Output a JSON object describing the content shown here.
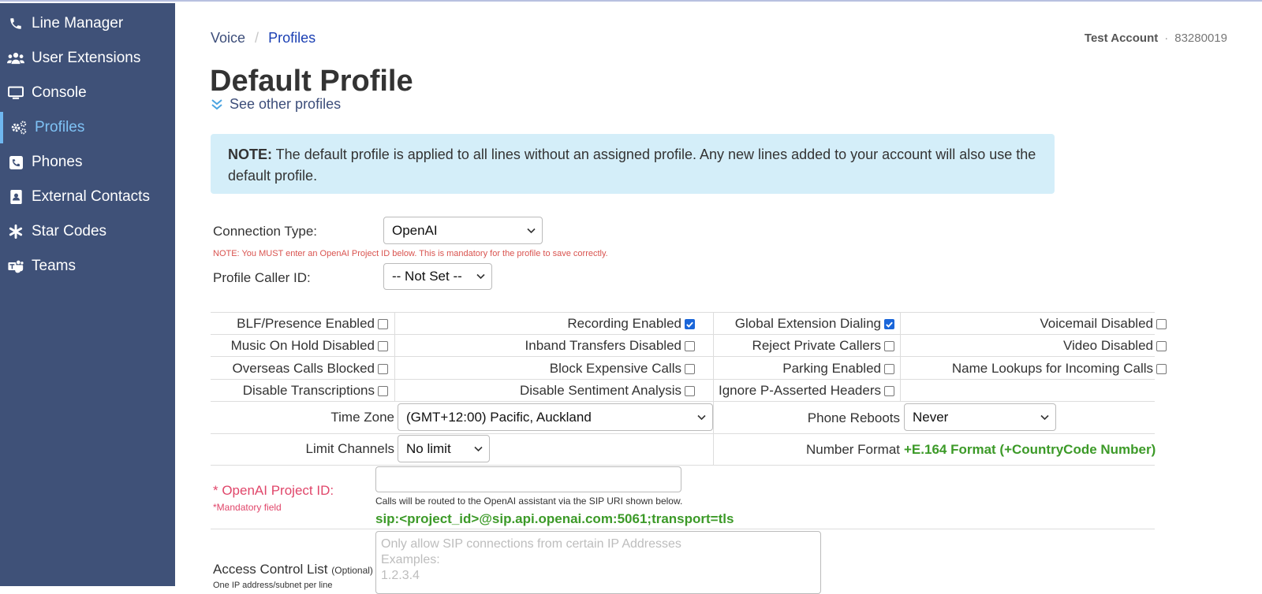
{
  "sidebar": {
    "items": [
      {
        "label": "Line Manager",
        "icon": "phone-icon"
      },
      {
        "label": "User Extensions",
        "icon": "users-icon"
      },
      {
        "label": "Console",
        "icon": "monitor-icon"
      },
      {
        "label": "Profiles",
        "icon": "gears-icon",
        "active": true
      },
      {
        "label": "Phones",
        "icon": "phone-square-icon"
      },
      {
        "label": "External Contacts",
        "icon": "contact-card-icon"
      },
      {
        "label": "Star Codes",
        "icon": "asterisk-icon"
      },
      {
        "label": "Teams",
        "icon": "teams-icon"
      }
    ]
  },
  "breadcrumb": {
    "root": "Voice",
    "separator": "/",
    "current": "Profiles"
  },
  "account": {
    "name": "Test Account",
    "separator": "·",
    "number": "83280019"
  },
  "page": {
    "title": "Default Profile",
    "see_other": "See other profiles"
  },
  "note": {
    "bold": "NOTE:",
    "text": " The default profile is applied to all lines without an assigned profile. Any new lines added to your account will also use the default profile."
  },
  "connection": {
    "label": "Connection Type:",
    "value": "OpenAI",
    "warning": "NOTE: You MUST enter an OpenAI Project ID below. This is mandatory for the profile to save correctly."
  },
  "caller_id": {
    "label": "Profile Caller ID:",
    "value": "-- Not Set --"
  },
  "options": {
    "col1": [
      {
        "label": "BLF/Presence Enabled",
        "checked": false
      },
      {
        "label": "Music On Hold Disabled",
        "checked": false
      },
      {
        "label": "Overseas Calls Blocked",
        "checked": false
      },
      {
        "label": "Disable Transcriptions",
        "checked": false
      }
    ],
    "col2": [
      {
        "label": "Recording Enabled",
        "checked": true
      },
      {
        "label": "Inband Transfers Disabled",
        "checked": false
      },
      {
        "label": "Block Expensive Calls",
        "checked": false
      },
      {
        "label": "Disable Sentiment Analysis",
        "checked": false
      }
    ],
    "col3": [
      {
        "label": "Global Extension Dialing",
        "checked": true
      },
      {
        "label": "Reject Private Callers",
        "checked": false
      },
      {
        "label": "Parking Enabled",
        "checked": false
      },
      {
        "label": "Ignore P-Asserted Headers",
        "checked": false
      }
    ],
    "col4": [
      {
        "label": "Voicemail Disabled",
        "checked": false
      },
      {
        "label": "Video Disabled",
        "checked": false
      },
      {
        "label": "Name Lookups for Incoming Calls",
        "checked": false
      }
    ]
  },
  "timezone": {
    "label": "Time Zone",
    "value": "(GMT+12:00) Pacific, Auckland"
  },
  "reboots": {
    "label": "Phone Reboots",
    "value": "Never"
  },
  "limit": {
    "label": "Limit Channels",
    "value": "No limit"
  },
  "number_format": {
    "label": "Number Format",
    "value": "+E.164 Format (+CountryCode Number)"
  },
  "openai": {
    "label": "* OpenAI Project ID:",
    "mandatory": "*Mandatory field",
    "value": "",
    "hint": "Calls will be routed to the OpenAI assistant via the SIP URI shown below.",
    "uri": "sip:<project_id>@sip.api.openai.com:5061;transport=tls"
  },
  "acl": {
    "label": "Access Control List",
    "optional": "(Optional)",
    "sublabel": "One IP address/subnet per line",
    "placeholder": "Only allow SIP connections from certain IP Addresses\nExamples:\n1.2.3.4"
  },
  "colors": {
    "sidebar": "#3f5178",
    "active": "#7fc2f5",
    "note_bg": "#d4eef9",
    "green": "#3c9a28",
    "warn": "#d9534f",
    "checkbox_checked": "#1a66d9"
  }
}
